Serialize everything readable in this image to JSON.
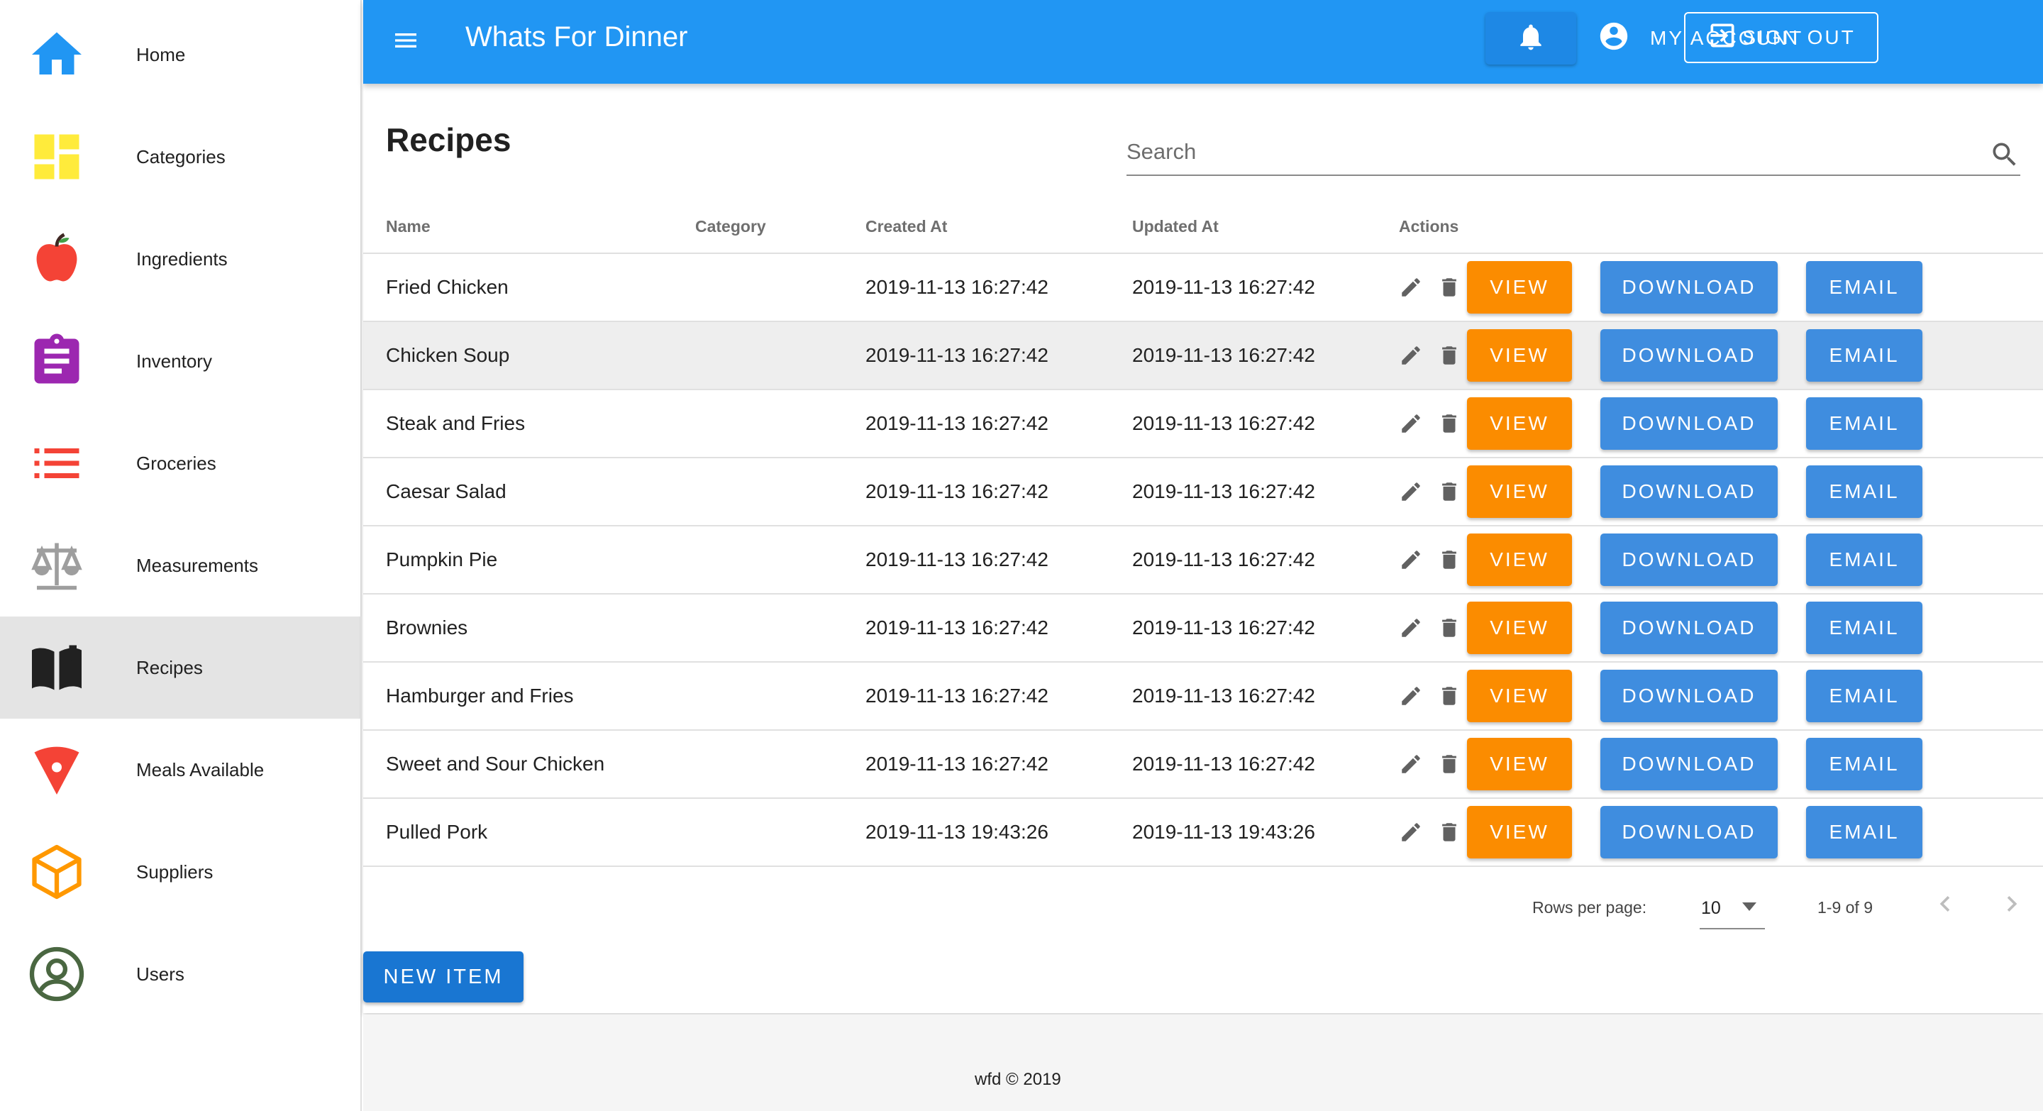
{
  "app": {
    "title": "Whats For Dinner",
    "account_label": "MY ACCOUNT",
    "signout_label": "SIGN OUT"
  },
  "sidebar": {
    "items": [
      {
        "label": "Home",
        "icon": "home-icon",
        "color": "#2196f3",
        "active": false
      },
      {
        "label": "Categories",
        "icon": "dashboard-icon",
        "color": "#ffeb3b",
        "active": false
      },
      {
        "label": "Ingredients",
        "icon": "apple-icon",
        "color": "#f44336",
        "active": false
      },
      {
        "label": "Inventory",
        "icon": "clipboard-icon",
        "color": "#9c27b0",
        "active": false
      },
      {
        "label": "Groceries",
        "icon": "list-icon",
        "color": "#f44336",
        "active": false
      },
      {
        "label": "Measurements",
        "icon": "scale-icon",
        "color": "#9e9e9e",
        "active": false
      },
      {
        "label": "Recipes",
        "icon": "book-icon",
        "color": "#212121",
        "active": true
      },
      {
        "label": "Meals Available",
        "icon": "pizza-icon",
        "color": "#f44336",
        "active": false
      },
      {
        "label": "Suppliers",
        "icon": "package-icon",
        "color": "#ff9800",
        "active": false
      },
      {
        "label": "Users",
        "icon": "account-circle-icon",
        "color": "#4a6741",
        "active": false
      }
    ]
  },
  "page": {
    "title": "Recipes",
    "search_placeholder": "Search"
  },
  "table": {
    "headers": {
      "name": "Name",
      "category": "Category",
      "created": "Created At",
      "updated": "Updated At",
      "actions": "Actions"
    },
    "button_labels": {
      "view": "VIEW",
      "download": "DOWNLOAD",
      "email": "EMAIL"
    },
    "rows": [
      {
        "name": "Fried Chicken",
        "category": "",
        "created": "2019-11-13 16:27:42",
        "updated": "2019-11-13 16:27:42"
      },
      {
        "name": "Chicken Soup",
        "category": "",
        "created": "2019-11-13 16:27:42",
        "updated": "2019-11-13 16:27:42"
      },
      {
        "name": "Steak and Fries",
        "category": "",
        "created": "2019-11-13 16:27:42",
        "updated": "2019-11-13 16:27:42"
      },
      {
        "name": "Caesar Salad",
        "category": "",
        "created": "2019-11-13 16:27:42",
        "updated": "2019-11-13 16:27:42"
      },
      {
        "name": "Pumpkin Pie",
        "category": "",
        "created": "2019-11-13 16:27:42",
        "updated": "2019-11-13 16:27:42"
      },
      {
        "name": "Brownies",
        "category": "",
        "created": "2019-11-13 16:27:42",
        "updated": "2019-11-13 16:27:42"
      },
      {
        "name": "Hamburger and Fries",
        "category": "",
        "created": "2019-11-13 16:27:42",
        "updated": "2019-11-13 16:27:42"
      },
      {
        "name": "Sweet and Sour Chicken",
        "category": "",
        "created": "2019-11-13 16:27:42",
        "updated": "2019-11-13 16:27:42"
      },
      {
        "name": "Pulled Pork",
        "category": "",
        "created": "2019-11-13 19:43:26",
        "updated": "2019-11-13 19:43:26"
      }
    ]
  },
  "pagination": {
    "rows_per_page_label": "Rows per page:",
    "rows_per_page": "10",
    "range": "1-9 of 9"
  },
  "new_item_label": "NEW ITEM",
  "footer": {
    "text": "wfd © 2019"
  },
  "colors": {
    "appbar": "#2196f3",
    "view_button": "#fb8c00",
    "download_button": "#3f8ddf",
    "email_button": "#3f8ddf",
    "new_item_button": "#1976d2"
  }
}
